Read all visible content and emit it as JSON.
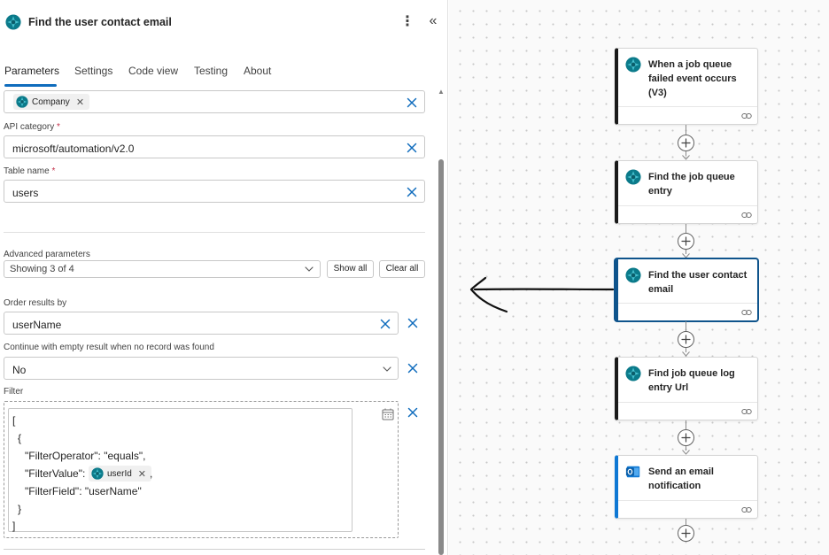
{
  "panel": {
    "title": "Find the user contact email",
    "tabs": [
      {
        "label": "Parameters",
        "active": true
      },
      {
        "label": "Settings",
        "active": false
      },
      {
        "label": "Code view",
        "active": false
      },
      {
        "label": "Testing",
        "active": false
      },
      {
        "label": "About",
        "active": false
      }
    ],
    "company_token": "Company",
    "api_category": {
      "label": "API category",
      "required_mark": "*",
      "value": "microsoft/automation/v2.0"
    },
    "table_name": {
      "label": "Table name",
      "required_mark": "*",
      "value": "users"
    },
    "advanced": {
      "label": "Advanced parameters",
      "selected": "Showing 3 of 4",
      "show_all": "Show all",
      "clear_all": "Clear all"
    },
    "order_by": {
      "label": "Order results by",
      "value": "userName"
    },
    "continue_empty": {
      "label": "Continue with empty result when no record was found",
      "value": "No"
    },
    "filter": {
      "label": "Filter",
      "lines": {
        "l1": "[",
        "l2": "{",
        "l3": "\"FilterOperator\": \"equals\",",
        "l4_prefix": "\"FilterValue\":",
        "l4_token": "userId",
        "l4_suffix": ",",
        "l5": "\"FilterField\": \"userName\"",
        "l6": "}",
        "l7": "]"
      }
    }
  },
  "flow": {
    "cards": [
      {
        "title": "When a job queue failed event occurs (V3)",
        "icon": "business-central-icon"
      },
      {
        "title": "Find the job queue entry",
        "icon": "business-central-icon"
      },
      {
        "title": "Find the user contact email",
        "icon": "business-central-icon",
        "selected": true
      },
      {
        "title": "Find job queue log entry Url",
        "icon": "business-central-icon"
      },
      {
        "title": "Send an email notification",
        "icon": "outlook-icon"
      }
    ]
  },
  "colors": {
    "accent": "#0f6cbd",
    "brand_teal": "#0a7c8c",
    "outlook_blue": "#0f78d4",
    "selected_border": "#0f548c"
  }
}
